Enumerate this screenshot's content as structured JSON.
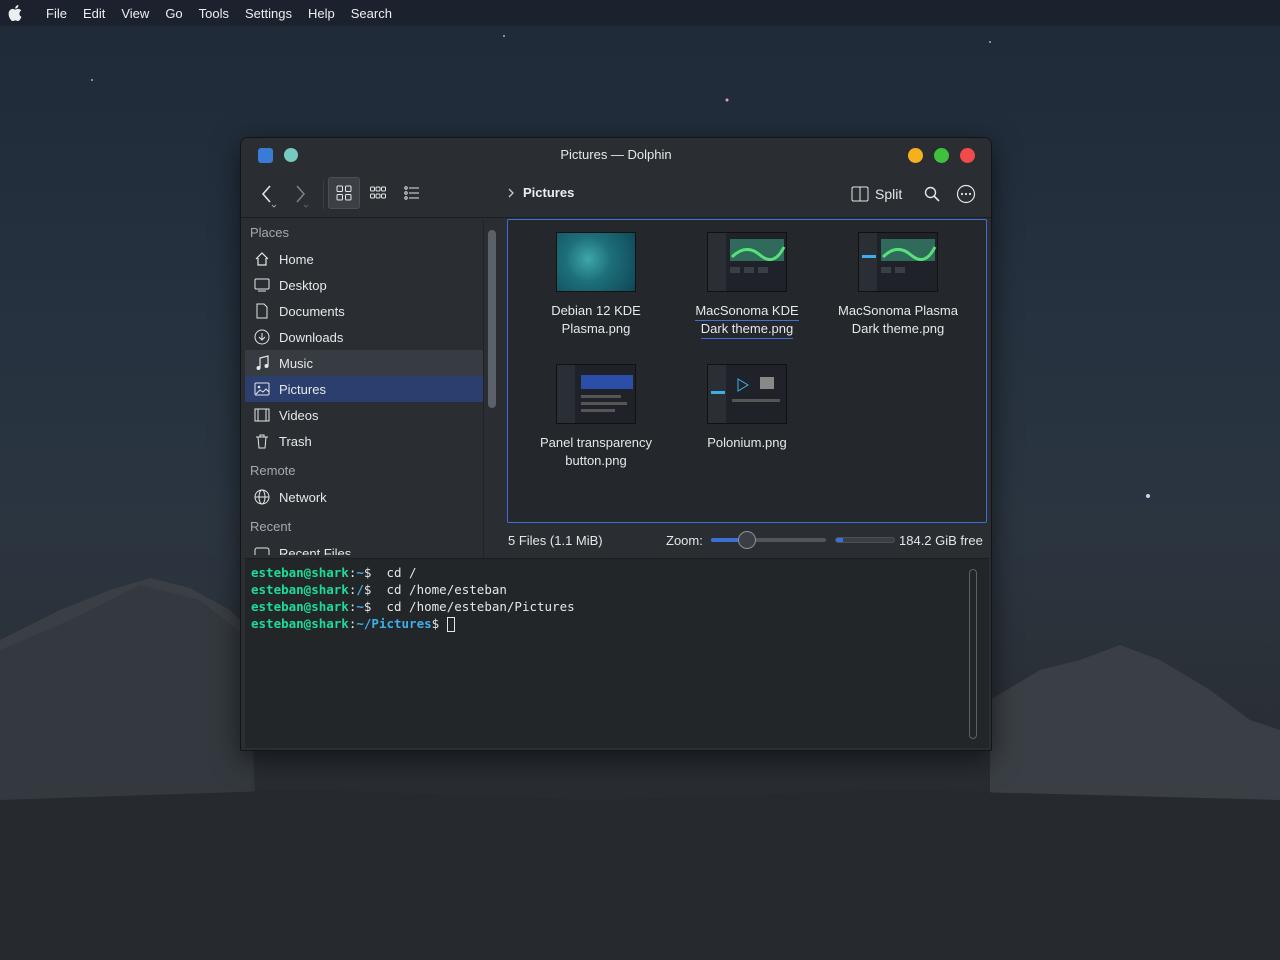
{
  "menubar": {
    "items": [
      "File",
      "Edit",
      "View",
      "Go",
      "Tools",
      "Settings",
      "Help",
      "Search"
    ]
  },
  "window": {
    "title": "Pictures — Dolphin"
  },
  "toolbar": {
    "breadcrumb": "Pictures",
    "split_label": "Split"
  },
  "sidebar": {
    "sections": {
      "places": "Places",
      "remote": "Remote",
      "recent": "Recent"
    },
    "places": [
      {
        "label": "Home",
        "icon": "home-icon"
      },
      {
        "label": "Desktop",
        "icon": "desktop-icon"
      },
      {
        "label": "Documents",
        "icon": "document-icon"
      },
      {
        "label": "Downloads",
        "icon": "download-icon"
      },
      {
        "label": "Music",
        "icon": "music-icon"
      },
      {
        "label": "Pictures",
        "icon": "picture-icon"
      },
      {
        "label": "Videos",
        "icon": "video-icon"
      },
      {
        "label": "Trash",
        "icon": "trash-icon"
      }
    ],
    "remote": [
      {
        "label": "Network",
        "icon": "network-icon"
      }
    ],
    "recent": [
      {
        "label": "Recent Files",
        "icon": "recent-files-icon"
      }
    ]
  },
  "files": [
    {
      "name": "Debian 12 KDE Plasma.png"
    },
    {
      "name": "MacSonoma KDE Dark theme.png"
    },
    {
      "name": "MacSonoma Plasma Dark theme.png"
    },
    {
      "name": "Panel transparency button.png"
    },
    {
      "name": "Polonium.png"
    }
  ],
  "statusbar": {
    "count": "5 Files (1.1 MiB)",
    "zoom_label": "Zoom:",
    "zoom_level": 0.28,
    "used_space_fraction": 0.12,
    "free_space": "184.2 GiB free"
  },
  "terminal": {
    "lines": [
      {
        "user": "esteban@shark",
        "path": "~",
        "command": "cd /"
      },
      {
        "user": "esteban@shark",
        "path": "/",
        "command": "cd /home/esteban"
      },
      {
        "user": "esteban@shark",
        "path": "~",
        "command": "cd /home/esteban/Pictures"
      },
      {
        "user": "esteban@shark",
        "path": "~/Pictures",
        "command": ""
      }
    ]
  },
  "colors": {
    "accent": "#3d6fd6",
    "terminal_user": "#1cdc9a",
    "terminal_path": "#3daee9",
    "close": "#f04a4a",
    "minimize": "#f5b01c",
    "maximize": "#3ec23e"
  }
}
